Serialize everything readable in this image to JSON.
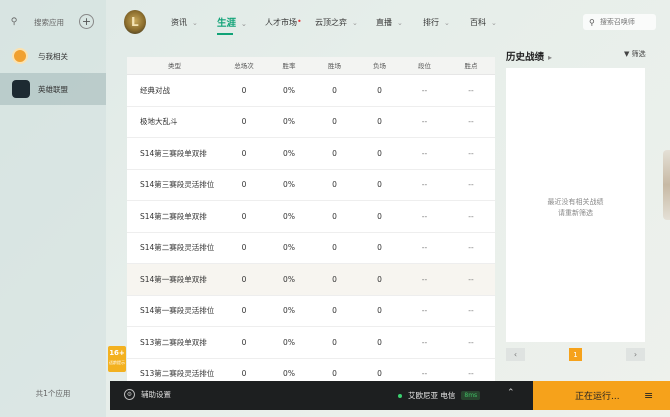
{
  "sidebar": {
    "search_label": "搜索应用",
    "items": [
      {
        "label": "与我相关"
      },
      {
        "label": "英雄联盟"
      }
    ],
    "footer": "共1个应用"
  },
  "nav": {
    "logo_letter": "L",
    "tabs": [
      {
        "label": "资讯",
        "chev": "⌄"
      },
      {
        "label": "生涯",
        "chev": "⌄"
      },
      {
        "label": "人才市场",
        "chev": ""
      },
      {
        "label": "云顶之弈",
        "chev": "⌄"
      },
      {
        "label": "直播",
        "chev": "⌄"
      },
      {
        "label": "排行",
        "chev": "⌄"
      },
      {
        "label": "百科",
        "chev": "⌄"
      }
    ],
    "search_placeholder": "搜索召唤师"
  },
  "table": {
    "headers": [
      "类型",
      "总场次",
      "胜率",
      "胜场",
      "负场",
      "段位",
      "胜点"
    ],
    "rows": [
      [
        "经典对战",
        "0",
        "0%",
        "0",
        "0",
        "--",
        "--"
      ],
      [
        "极地大乱斗",
        "0",
        "0%",
        "0",
        "0",
        "--",
        "--"
      ],
      [
        "S14第三赛段单双排",
        "0",
        "0%",
        "0",
        "0",
        "--",
        "--"
      ],
      [
        "S14第三赛段灵活排位",
        "0",
        "0%",
        "0",
        "0",
        "--",
        "--"
      ],
      [
        "S14第二赛段单双排",
        "0",
        "0%",
        "0",
        "0",
        "--",
        "--"
      ],
      [
        "S14第二赛段灵活排位",
        "0",
        "0%",
        "0",
        "0",
        "--",
        "--"
      ],
      [
        "S14第一赛段单双排",
        "0",
        "0%",
        "0",
        "0",
        "--",
        "--"
      ],
      [
        "S14第一赛段灵活排位",
        "0",
        "0%",
        "0",
        "0",
        "--",
        "--"
      ],
      [
        "S13第二赛段单双排",
        "0",
        "0%",
        "0",
        "0",
        "--",
        "--"
      ],
      [
        "S13第二赛段灵活排位",
        "0",
        "0%",
        "0",
        "0",
        "--",
        "--"
      ]
    ]
  },
  "history": {
    "title": "历史战绩",
    "filter": "筛选",
    "empty_line1": "最近没有相关战绩",
    "empty_line2": "请重新筛选",
    "page": "1"
  },
  "age_badge": {
    "age": "16+",
    "text": "适龄提示"
  },
  "bottom": {
    "assist": "辅助设置",
    "server": "艾欧尼亚 电信",
    "ping": "8ms",
    "running": "正在运行..."
  },
  "colors": {
    "accent": "#11a377",
    "running": "#f6a21b"
  }
}
